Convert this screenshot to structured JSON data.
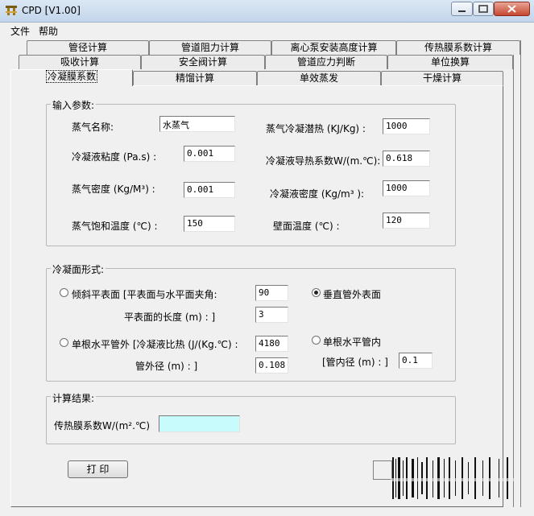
{
  "window": {
    "title": "CPD [V1.00]"
  },
  "menu": [
    "文件",
    "帮助"
  ],
  "tabs": {
    "row1": [
      "管径计算",
      "管道阻力计算",
      "离心泵安装高度计算",
      "传热膜系数计算"
    ],
    "row2": [
      "吸收计算",
      "安全阀计算",
      "管道应力判断",
      "单位换算"
    ],
    "row3": [
      "冷凝膜系数",
      "精馏计算",
      "单效蒸发",
      "干燥计算"
    ]
  },
  "input_params": {
    "title": "输入参数:",
    "vapor_name": {
      "label": "蒸气名称:",
      "value": "水蒸气"
    },
    "latent_heat": {
      "label": "蒸气冷凝潜热 (KJ/Kg) :",
      "value": "1000"
    },
    "viscosity": {
      "label": "冷凝液粘度 (Pa.s) :",
      "value": "0.001"
    },
    "conductivity": {
      "label": "冷凝液导热系数W/(m.℃):",
      "value": "0.618"
    },
    "vapor_density": {
      "label": "蒸气密度 (Kg/M³) :",
      "value": "0.001"
    },
    "liquid_density": {
      "label": "冷凝液密度 (Kg/m³ ):",
      "value": "1000"
    },
    "sat_temp": {
      "label": "蒸气饱和温度 (℃) :",
      "value": "150"
    },
    "wall_temp": {
      "label": "壁面温度 (℃) :",
      "value": "120"
    }
  },
  "surface_form": {
    "title": "冷凝面形式:",
    "incline": {
      "label": "倾斜平表面 [平表面与水平面夹角:",
      "value": "90",
      "checked": false
    },
    "plane_length": {
      "label": "平表面的长度 (m) : ]",
      "value": "3"
    },
    "vertical_outer": {
      "label": "垂直管外表面",
      "checked": true
    },
    "horizontal_outer": {
      "label": "单根水平管外 [冷凝液比热 (J/(Kg.℃) :",
      "value": "4180",
      "checked": false
    },
    "outer_diameter": {
      "label": "管外径 (m) : ]",
      "value": "0.108"
    },
    "horizontal_inner": {
      "label": "单根水平管内",
      "checked": false
    },
    "inner_diameter": {
      "label": "[管内径 (m) : ]",
      "value": "0.1"
    }
  },
  "results": {
    "title": "计算结果:",
    "coefficient": {
      "label": "传热膜系数W/(m².℃)",
      "value": ""
    }
  },
  "print_button": "打 印",
  "colors": {
    "result_bg": "#c8fcfc",
    "title_gradient": "#c3d6ec"
  }
}
